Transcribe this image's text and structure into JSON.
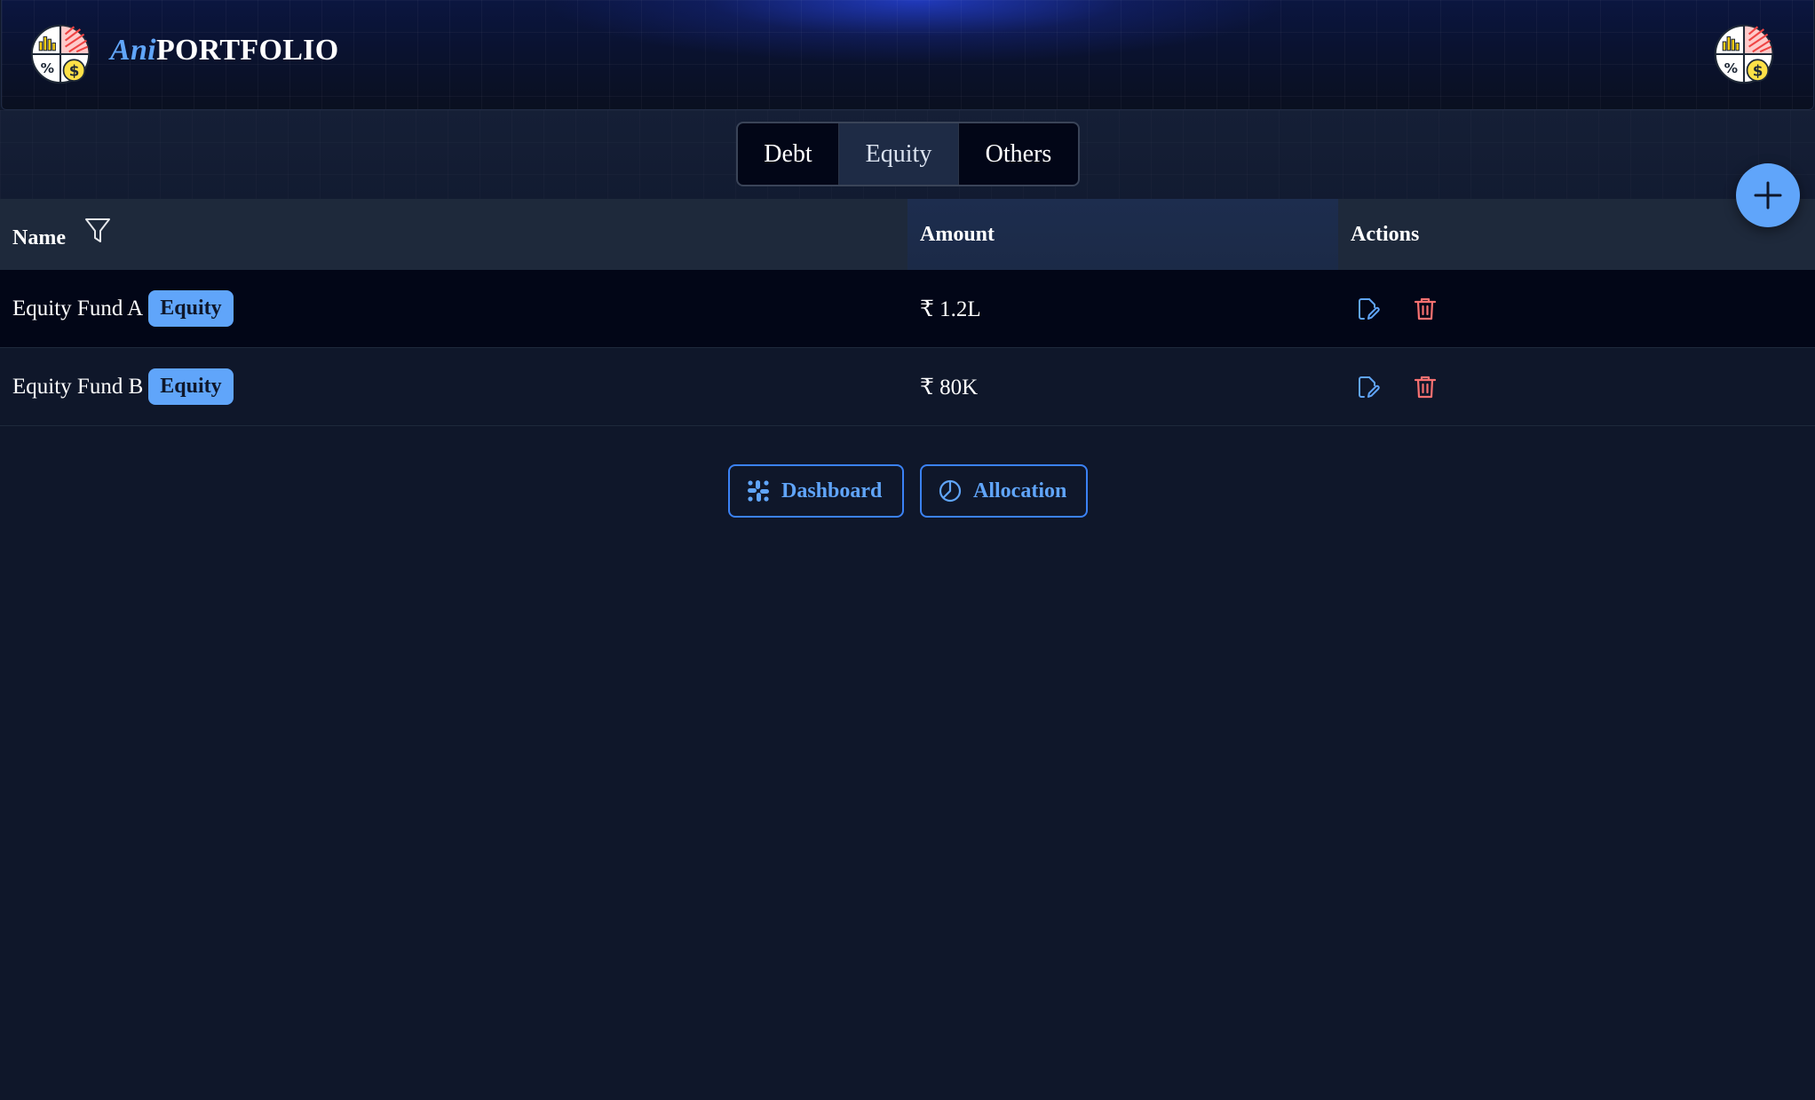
{
  "header": {
    "brand_prefix": "Ani",
    "brand_main": "PORTFOLIO"
  },
  "tabs": [
    {
      "label": "Debt",
      "active": false
    },
    {
      "label": "Equity",
      "active": true
    },
    {
      "label": "Others",
      "active": false
    }
  ],
  "table": {
    "columns": {
      "name": "Name",
      "amount": "Amount",
      "actions": "Actions"
    },
    "rows": [
      {
        "name": "Equity Fund A",
        "badge": "Equity",
        "amount": "₹ 1.2L"
      },
      {
        "name": "Equity Fund B",
        "badge": "Equity",
        "amount": "₹ 80K"
      }
    ]
  },
  "nav": {
    "dashboard": "Dashboard",
    "allocation": "Allocation"
  },
  "colors": {
    "accent": "#60a5fa",
    "background": "#0f172a",
    "delete": "#f87171",
    "header_glow": "#2846e6"
  },
  "icons": {
    "logo": "portfolio-logo-icon",
    "add": "plus-icon",
    "filter": "filter-icon",
    "edit": "edit-icon",
    "delete": "trash-icon",
    "dashboard": "dashboard-icon",
    "allocation": "pie-chart-icon"
  }
}
